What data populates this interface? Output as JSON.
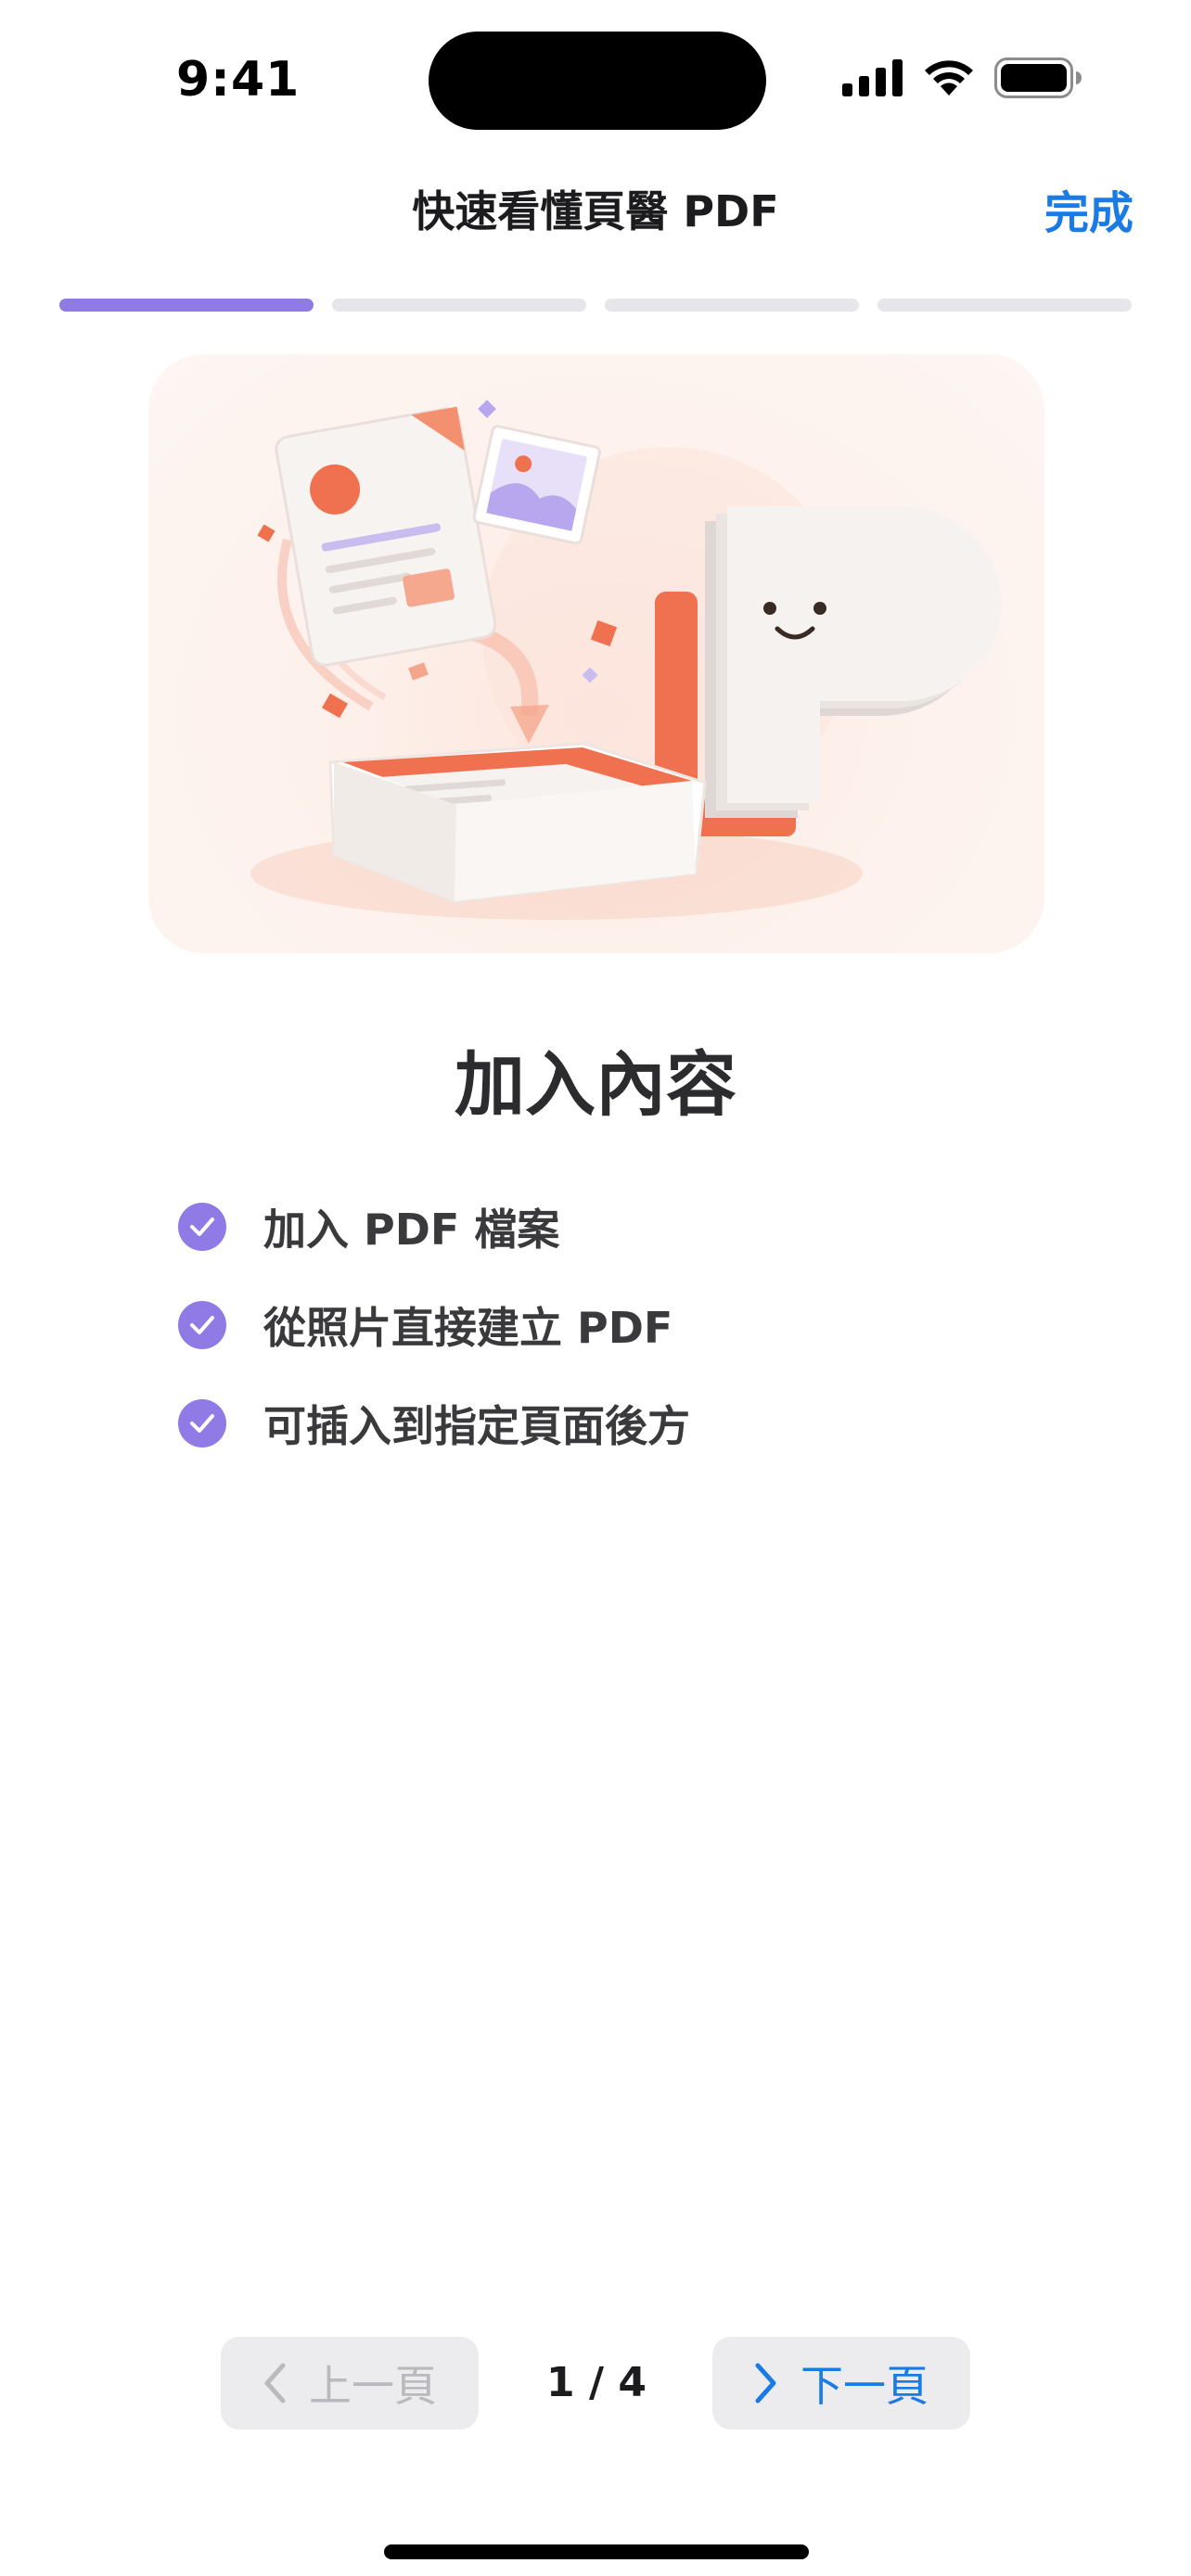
{
  "status_bar": {
    "time": "9:41",
    "icons": [
      "cellular-signal-icon",
      "wifi-icon",
      "battery-icon"
    ]
  },
  "nav": {
    "title": "快速看懂頁醫 PDF",
    "done_label": "完成"
  },
  "progress": {
    "total_steps": 4,
    "current_step": 1
  },
  "content": {
    "heading": "加入內容",
    "features": [
      "加入 PDF 檔案",
      "從照片直接建立 PDF",
      "可插入到指定頁面後方"
    ]
  },
  "pager": {
    "prev_label": "上一頁",
    "next_label": "下一頁",
    "page_indicator": "1 / 4"
  },
  "colors": {
    "accent_purple": "#8f7ae6",
    "link_blue": "#1a7ae6",
    "illustration_orange": "#f0714f"
  }
}
